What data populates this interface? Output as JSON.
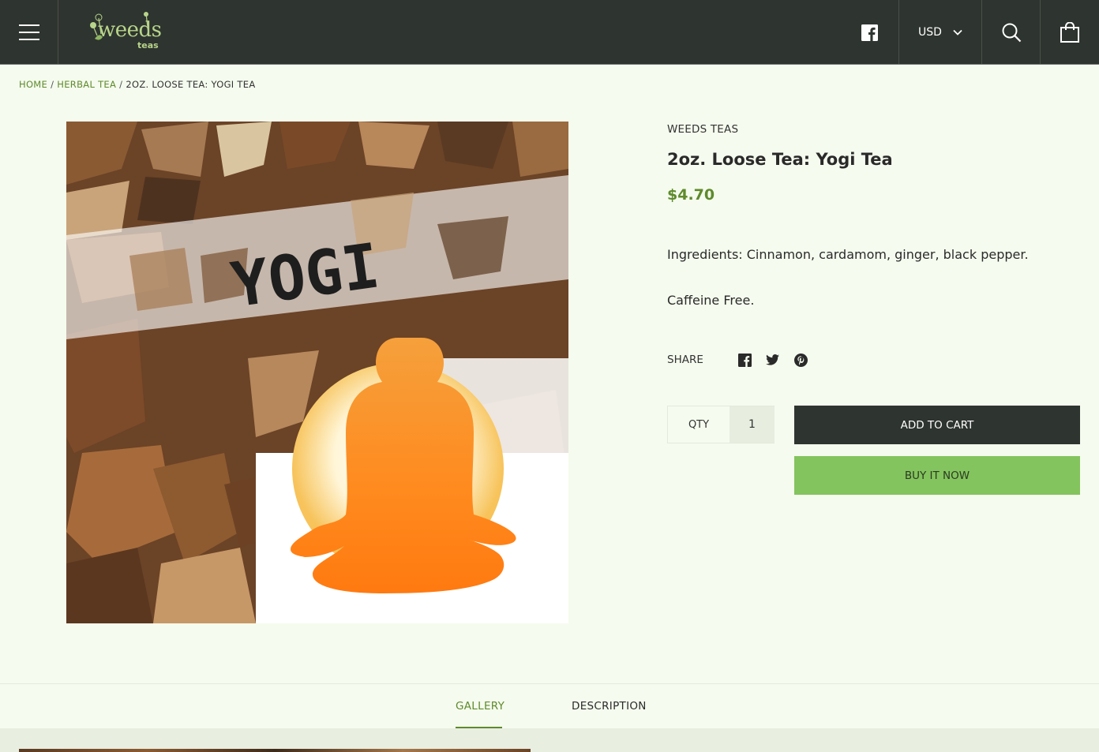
{
  "header": {
    "menu_icon": "hamburger-menu-icon",
    "logo": {
      "word": "weeds",
      "sub": "teas"
    },
    "social_icon": "facebook-icon",
    "currency": {
      "selected": "USD",
      "icon": "chevron-down-icon"
    },
    "search_icon": "search-icon",
    "cart_icon": "shopping-bag-icon"
  },
  "breadcrumb": {
    "items": [
      {
        "label": "HOME"
      },
      {
        "label": "HERBAL TEA"
      }
    ],
    "separator": "/",
    "current": "2OZ. LOOSE TEA: YOGI TEA"
  },
  "product": {
    "image_text": "YOGI",
    "vendor": "WEEDS TEAS",
    "title": "2oz. Loose Tea: Yogi Tea",
    "price": "$4.70",
    "ingredients": "Ingredients: Cinnamon, cardamom, ginger, black pepper.",
    "caffeine": "Caffeine Free."
  },
  "share": {
    "label": "SHARE",
    "icons": [
      "facebook-icon",
      "twitter-icon",
      "pinterest-icon"
    ]
  },
  "purchase": {
    "qty_label": "QTY",
    "qty_value": "1",
    "add_to_cart": "ADD TO CART",
    "buy_now": "BUY IT NOW"
  },
  "tabs": [
    {
      "label": "GALLERY",
      "active": true
    },
    {
      "label": "DESCRIPTION",
      "active": false
    }
  ],
  "colors": {
    "header_bg": "#2e342f",
    "page_bg": "#f5fbee",
    "accent_green": "#5f8a2c",
    "buy_button": "#84c45e"
  }
}
